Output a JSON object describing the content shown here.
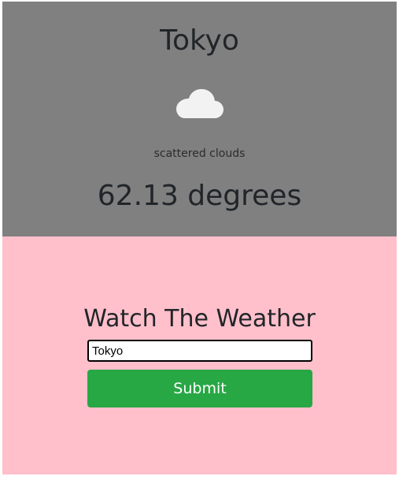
{
  "weather": {
    "city": "Tokyo",
    "icon": "cloud-icon",
    "description": "scattered clouds",
    "temperature": "62.13 degrees"
  },
  "form": {
    "title": "Watch The Weather",
    "input_value": "Tokyo",
    "submit_label": "Submit"
  },
  "colors": {
    "weather_bg": "#808080",
    "form_bg": "#ffc0cb",
    "button_bg": "#28a745",
    "text": "#212529",
    "cloud": "#f2f2f2"
  }
}
